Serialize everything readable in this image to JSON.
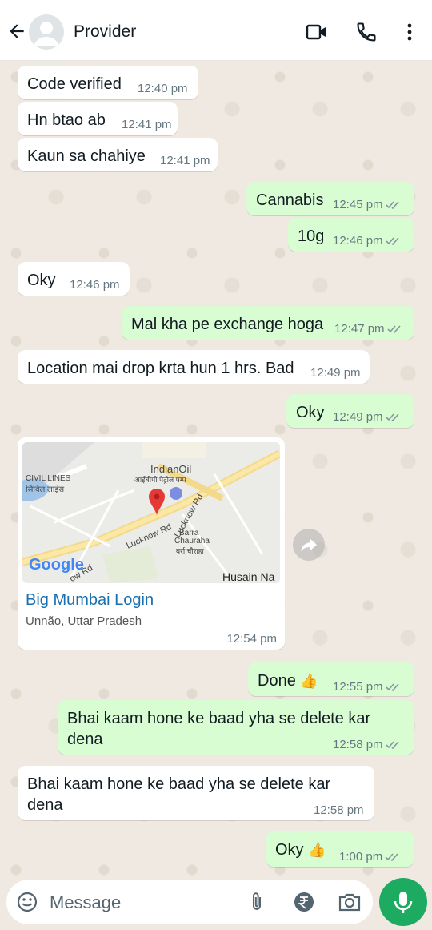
{
  "header": {
    "contact_name": "Provider"
  },
  "messages": [
    {
      "dir": "in",
      "text": "Code verified",
      "time": "12:40 pm"
    },
    {
      "dir": "in",
      "text": "Hn btao ab",
      "time": "12:41 pm"
    },
    {
      "dir": "in",
      "text": "Kaun sa chahiye",
      "time": "12:41 pm"
    },
    {
      "dir": "out",
      "text": "Cannabis",
      "time": "12:45 pm"
    },
    {
      "dir": "out",
      "text": "10g",
      "time": "12:46 pm"
    },
    {
      "dir": "in",
      "text": "Oky",
      "time": "12:46 pm"
    },
    {
      "dir": "out",
      "text": "Mal kha pe exchange hoga",
      "time": "12:47 pm"
    },
    {
      "dir": "in",
      "text": "Location mai drop krta hun 1 hrs. Bad",
      "time": "12:49 pm"
    },
    {
      "dir": "out",
      "text": "Oky",
      "time": "12:49 pm"
    },
    {
      "dir": "out",
      "text": "Done",
      "time": "12:55 pm"
    },
    {
      "dir": "out",
      "text": "Bhai kaam hone ke baad yha se delete kar dena",
      "time": "12:58 pm"
    },
    {
      "dir": "in",
      "text": "Bhai kaam hone ke baad yha se delete kar dena",
      "time": "12:58 pm"
    },
    {
      "dir": "out",
      "text": "Oky",
      "time": "1:00 pm"
    }
  ],
  "location": {
    "title": "Big Mumbai Login",
    "subtitle": "Unnão, Uttar Pradesh",
    "time": "12:54 pm",
    "map_labels": {
      "civil_lines": "CIVIL LINES",
      "civil_lines_hi": "सिविल लाइंस",
      "indianoil": "IndianOil",
      "indianoil_hi": "आईबीपी पेट्रोल पम्प",
      "lucknow_rd": "Lucknow Rd",
      "barra": "Barra",
      "chauraha": "Chauraha",
      "barra_hi": "बर्रा चौराहा",
      "husain": "Husain Na",
      "google": "Google",
      "lucknow_rd_2": "Lucknow Rd",
      "lucknow_rd_3": "ow Rd"
    }
  },
  "input": {
    "placeholder": "Message"
  },
  "emoji": {
    "thumbs_up": "👍"
  },
  "colors": {
    "incoming": "#ffffff",
    "outgoing": "#d9fdd3",
    "mic": "#1daa61",
    "link": "#1a6fb0",
    "tick": "#8696a0"
  }
}
